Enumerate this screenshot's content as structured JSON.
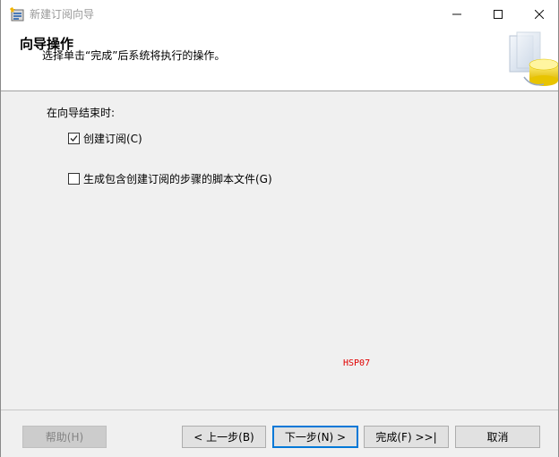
{
  "window": {
    "title": "新建订阅向导",
    "controls": {
      "minimize": "minimize",
      "maximize": "maximize",
      "close": "close"
    }
  },
  "header": {
    "title": "向导操作",
    "subtitle": "选择单击“完成”后系统将执行的操作。"
  },
  "body": {
    "prompt": "在向导结束时:",
    "options": [
      {
        "label": "创建订阅(C)",
        "checked": true
      },
      {
        "label": "生成包含创建订阅的步骤的脚本文件(G)",
        "checked": false
      }
    ],
    "server_tag": "HSP07"
  },
  "footer": {
    "help": "帮助(H)",
    "back": "< 上一步(B)",
    "next": "下一步(N) >",
    "finish": "完成(F) >>|",
    "cancel": "取消"
  },
  "colors": {
    "server_tag": "#e00000",
    "default_button_border": "#0078d7"
  }
}
